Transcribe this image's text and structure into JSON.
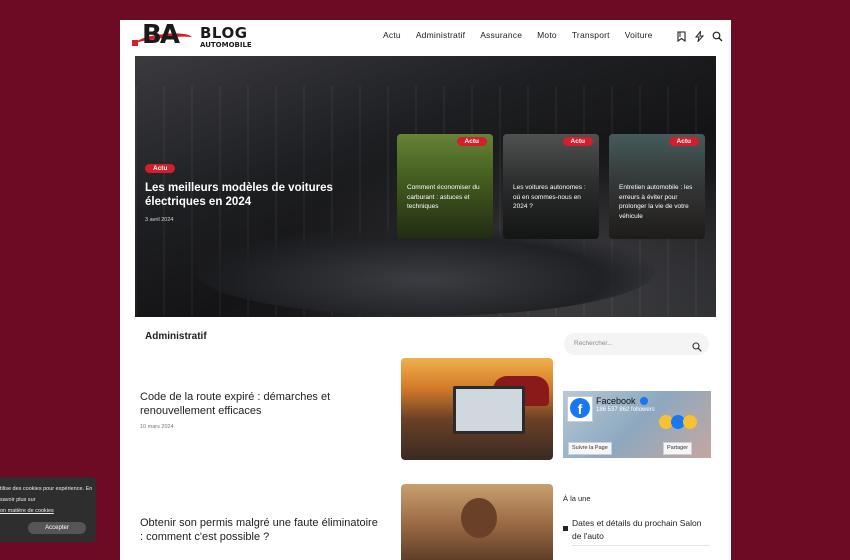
{
  "brand": {
    "logo_letters": "BA",
    "name": "BLOG",
    "sub": "AUTOMOBILE"
  },
  "nav": [
    "Actu",
    "Administratif",
    "Assurance",
    "Moto",
    "Transport",
    "Voiture"
  ],
  "header_icons": [
    "bookmark-icon",
    "lightning-icon",
    "search-icon"
  ],
  "hero": {
    "badge": "Actu",
    "title": "Les meilleurs modèles de voitures électriques en 2024",
    "date": "3 avril 2024",
    "cards": [
      {
        "badge": "Actu",
        "title": "Comment économiser du carburant : astuces et techniques"
      },
      {
        "badge": "Actu",
        "title": "Les voitures autonomes : où en sommes-nous en 2024 ?"
      },
      {
        "badge": "Actu",
        "title": "Entretien automobile : les erreurs à éviter pour prolonger la vie de votre véhicule"
      }
    ]
  },
  "section": {
    "title": "Administratif"
  },
  "posts": [
    {
      "title": "Code de la route expiré : démarches et renouvellement efficaces",
      "date": "10 mars 2024"
    },
    {
      "title": "Obtenir son permis malgré une faute éliminatoire : comment c'est possible ?",
      "date": ""
    }
  ],
  "sidebar": {
    "search_placeholder": "Rechercher...",
    "facebook": {
      "name": "Facebook",
      "followers": "186 537 862 followers",
      "follow_label": "Suivre la Page",
      "share_label": "Partager"
    },
    "a_la_une_label": "À la une",
    "a_la_une_item": "Dates et détails du prochain Salon de l'auto"
  },
  "cookie": {
    "text": "tilise des cookies pour expérience. En savoir plus sur",
    "link": "on matière de cookies",
    "accept": "Accepter"
  },
  "colors": {
    "background": "#6d0a24",
    "accent": "#d21f2b",
    "facebook": "#1877f2"
  }
}
